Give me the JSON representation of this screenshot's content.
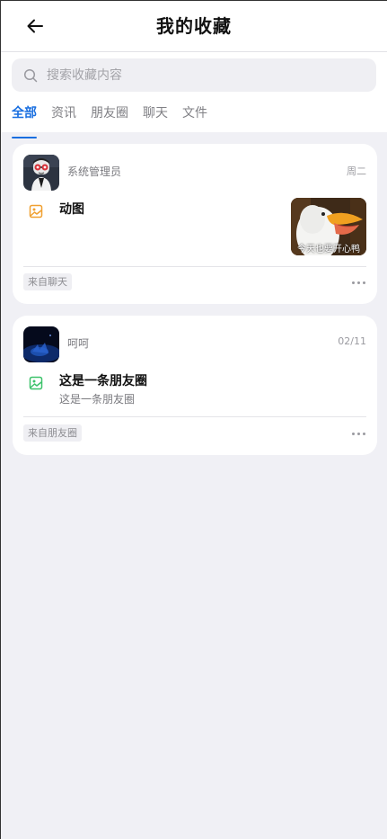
{
  "header": {
    "title": "我的收藏"
  },
  "search": {
    "placeholder": "搜索收藏内容"
  },
  "tabs": [
    {
      "label": "全部",
      "active": true
    },
    {
      "label": "资讯",
      "active": false
    },
    {
      "label": "朋友圈",
      "active": false
    },
    {
      "label": "聊天",
      "active": false
    },
    {
      "label": "文件",
      "active": false
    }
  ],
  "items": [
    {
      "sender": "系统管理员",
      "date": "周二",
      "type_icon": "image-icon",
      "type_color": "#f0a030",
      "title": "动图",
      "thumbnail_caption": "今天也要开心鸭",
      "source": "来自聊天"
    },
    {
      "sender": "呵呵",
      "date": "02/11",
      "type_icon": "image-icon",
      "type_color": "#3cc26a",
      "title": "这是一条朋友圈",
      "subtitle": "这是一条朋友圈",
      "source": "来自朋友圈"
    }
  ],
  "colors": {
    "accent": "#1a6fe0",
    "background": "#f0f0f5"
  }
}
